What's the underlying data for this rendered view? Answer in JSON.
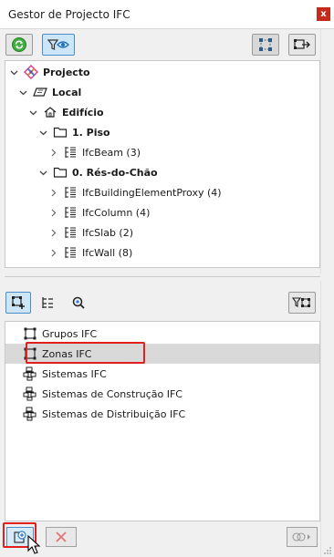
{
  "window": {
    "title": "Gestor de Projecto IFC",
    "close_label": "x"
  },
  "colors": {
    "accent_blue": "#4b8ec9",
    "active_bg": "#cde6f7",
    "highlight_red": "#e0201f",
    "selected_row": "#d9d9d9",
    "close_red": "#c42b1c"
  },
  "toolbar_top": {
    "icons": [
      "refresh-icon",
      "filter-view-icon",
      "select-element-icon",
      "locate-element-icon"
    ]
  },
  "tree": {
    "nodes": [
      {
        "label": "Projecto",
        "bold": true
      },
      {
        "label": "Local",
        "bold": true
      },
      {
        "label": "Edifício",
        "bold": true
      },
      {
        "label": "1. Piso",
        "bold": true
      },
      {
        "label": "IfcBeam (3)",
        "bold": false
      },
      {
        "label": "0. Rés-do-Chão",
        "bold": true
      },
      {
        "label": "IfcBuildingElementProxy (4)",
        "bold": false
      },
      {
        "label": "IfcColumn (4)",
        "bold": false
      },
      {
        "label": "IfcSlab (2)",
        "bold": false
      },
      {
        "label": "IfcWall (8)",
        "bold": false
      }
    ]
  },
  "toolbar_mid": {
    "icons": [
      "assignments-icon",
      "hierarchy-icon",
      "search-icon",
      "filter-select-icon"
    ]
  },
  "list": {
    "items": [
      {
        "label": "Grupos IFC",
        "selected": false
      },
      {
        "label": "Zonas IFC",
        "selected": true
      },
      {
        "label": "Sistemas IFC",
        "selected": false
      },
      {
        "label": "Sistemas de Construção IFC",
        "selected": false
      },
      {
        "label": "Sistemas de Distribuição IFC",
        "selected": false
      }
    ]
  },
  "toolbar_bottom": {
    "icons": [
      "new-assignment-icon",
      "delete-icon",
      "more-options-icon"
    ]
  }
}
